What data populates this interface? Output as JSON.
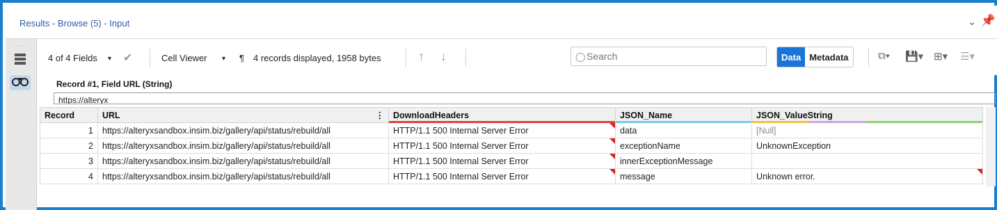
{
  "window": {
    "title": "Results - Browse (5) - Input"
  },
  "toolbar": {
    "fields_label": "4 of 4 Fields",
    "cell_viewer_label": "Cell Viewer",
    "pilcrow": "¶",
    "records_info": "4 records displayed, 1958 bytes",
    "search_placeholder": "Search",
    "data_label": "Data",
    "metadata_label": "Metadata"
  },
  "cell_viewer": {
    "label": "Record #1, Field URL (String)",
    "value": "https://alteryx"
  },
  "table": {
    "columns": [
      "Record",
      "URL",
      "DownloadHeaders",
      "JSON_Name",
      "JSON_ValueString"
    ],
    "header_colors": [
      "",
      "#f0f0f0",
      "#e04040",
      "#7cc8e8",
      "#8fd070"
    ],
    "rows": [
      {
        "record": "1",
        "url": "https://alteryxsandbox.insim.biz/gallery/api/status/rebuild/all",
        "headers": "HTTP/1.1 500 Internal Server Error",
        "name": "data",
        "value": "[Null]"
      },
      {
        "record": "2",
        "url": "https://alteryxsandbox.insim.biz/gallery/api/status/rebuild/all",
        "headers": "HTTP/1.1 500 Internal Server Error",
        "name": "exceptionName",
        "value": "UnknownException"
      },
      {
        "record": "3",
        "url": "https://alteryxsandbox.insim.biz/gallery/api/status/rebuild/all",
        "headers": "HTTP/1.1 500 Internal Server Error",
        "name": "innerExceptionMessage",
        "value": ""
      },
      {
        "record": "4",
        "url": "https://alteryxsandbox.insim.biz/gallery/api/status/rebuild/all",
        "headers": "HTTP/1.1 500 Internal Server Error",
        "name": "message",
        "value": "Unknown error."
      }
    ]
  }
}
